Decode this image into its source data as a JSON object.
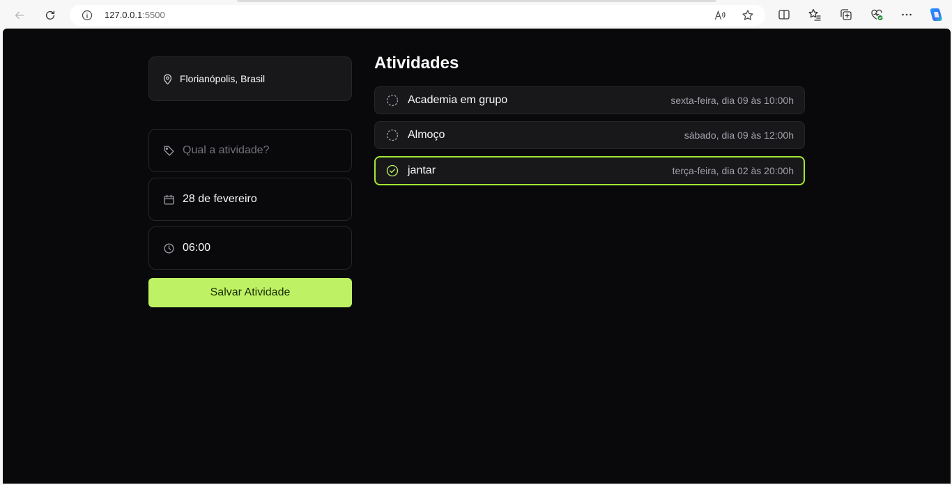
{
  "browser": {
    "url_host": "127.0.0.1",
    "url_port": ":5500",
    "icons": [
      "back-icon",
      "reload-icon",
      "info-icon",
      "read-aloud-icon",
      "favorite-star-icon",
      "split-screen-icon",
      "favorites-list-icon",
      "collections-icon",
      "browser-essentials-icon",
      "more-icon",
      "copilot-icon"
    ]
  },
  "location": {
    "label": "Florianópolis, Brasil"
  },
  "form": {
    "activity_placeholder": "Qual a atividade?",
    "date_value": "28 de fevereiro",
    "time_value": "06:00",
    "save_label": "Salvar Atividade"
  },
  "activities": {
    "title": "Atividades",
    "items": [
      {
        "name": "Academia em grupo",
        "when": "sexta-feira, dia 09 às 10:00h",
        "done": false
      },
      {
        "name": "Almoço",
        "when": "sábado, dia 09 às 12:00h",
        "done": false
      },
      {
        "name": "jantar",
        "when": "terça-feira, dia 02 às 20:00h",
        "done": true
      }
    ]
  },
  "colors": {
    "background": "#09090b",
    "surface": "#18181b",
    "border": "#27272a",
    "accent": "#bef264",
    "accent_border": "#a3e635",
    "text": "#fafafa",
    "muted": "#a1a1aa"
  }
}
